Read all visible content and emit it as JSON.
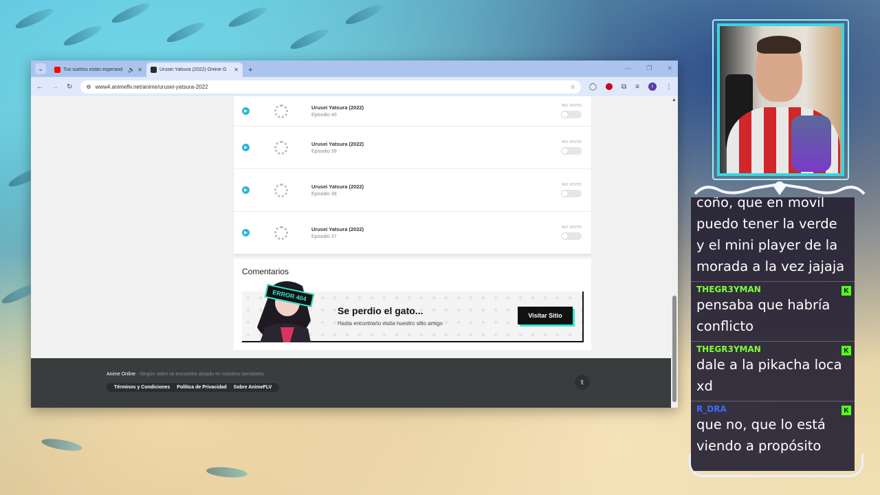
{
  "browser": {
    "tabs": [
      {
        "title": "Tus sueños están esperand",
        "active": false,
        "favicon_color": "#ff0000",
        "has_audio": true
      },
      {
        "title": "Urusei Yatsura (2022) Online G",
        "active": true,
        "favicon_color": "#2b2b2b",
        "has_audio": false
      }
    ],
    "new_tab_label": "+",
    "back_icon": "←",
    "forward_icon": "→",
    "reload_icon": "↻",
    "url": "www4.animeflv.net/anime/urusei-yatsura-2022",
    "window_controls": [
      "—",
      "❐",
      "✕"
    ],
    "profile_initial": "I"
  },
  "episodes": [
    {
      "series": "Urusei Yatsura (2022)",
      "episode": "Episodio 40",
      "status": "NO VISTO"
    },
    {
      "series": "Urusei Yatsura (2022)",
      "episode": "Episodio 39",
      "status": "NO VISTO"
    },
    {
      "series": "Urusei Yatsura (2022)",
      "episode": "Episodio 38",
      "status": "NO VISTO"
    },
    {
      "series": "Urusei Yatsura (2022)",
      "episode": "Episodio 37",
      "status": "NO VISTO"
    }
  ],
  "comments": {
    "heading": "Comentarios",
    "banner": {
      "badge": "ERROR 404",
      "headline": "Se perdio el gato...",
      "subtext": "Hasta encontrarlo visita nuestro sitio amigo",
      "button": "Visitar Sitio"
    }
  },
  "footer": {
    "brand": "Anime Online",
    "notice": " - Ningún video se encuentra alojado en nuestros servidores.",
    "links": [
      "Términos y Condiciones",
      "Política de Privacidad",
      "Sobre AnimeFLV"
    ],
    "twitter_icon": "🐦"
  },
  "chat": {
    "messages": [
      {
        "user": "",
        "text": "coño, que en movil puedo tener la verde y el mini player de la morada a la vez jajaja",
        "user_color": "#7dff3a"
      },
      {
        "user": "THEGR3YMAN",
        "text": "pensaba que habría conflicto",
        "user_color": "#7dff3a"
      },
      {
        "user": "THEGR3YMAN",
        "text": "dale a la pikacha loca xd",
        "user_color": "#7dff3a"
      },
      {
        "user": "R_DRA",
        "text": "que no, que lo está viendo a propósito",
        "user_color": "#3a6dff"
      }
    ],
    "platform_badge": "K"
  },
  "colors": {
    "accent_teal": "#2bb6d8",
    "kick_green": "#53fc18",
    "footer_bg": "#3a3d3e",
    "tab_bar": "#aac4ee"
  }
}
